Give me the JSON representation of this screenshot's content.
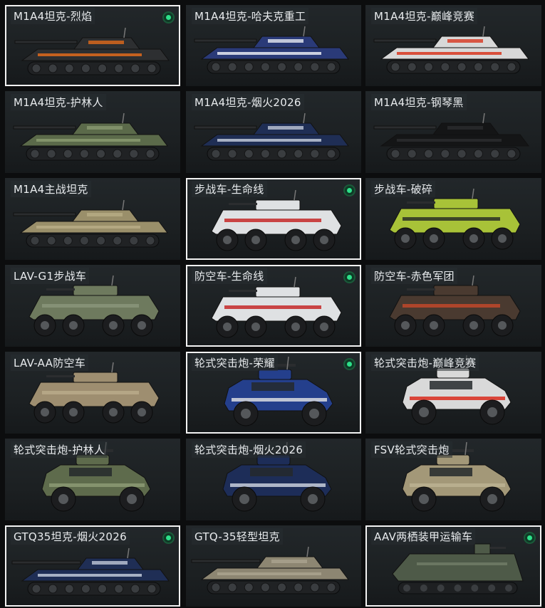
{
  "vehicles": [
    {
      "name": "M1A4坦克-烈焰",
      "selected": true,
      "owned": true,
      "type": "tank",
      "body": "#2d2f31",
      "accent": "#e06a1c"
    },
    {
      "name": "M1A4坦克-哈夫克重工",
      "selected": false,
      "owned": false,
      "type": "tank",
      "body": "#2a3a78",
      "accent": "#e7ebf2"
    },
    {
      "name": "M1A4坦克-巅峰竞赛",
      "selected": false,
      "owned": false,
      "type": "tank",
      "body": "#d8d8d8",
      "accent": "#d8361f"
    },
    {
      "name": "M1A4坦克-护林人",
      "selected": false,
      "owned": false,
      "type": "tank",
      "body": "#5b6a4a",
      "accent": "#8a9a70"
    },
    {
      "name": "M1A4坦克-烟火2026",
      "selected": false,
      "owned": false,
      "type": "tank",
      "body": "#1f2e55",
      "accent": "#c0c8d8"
    },
    {
      "name": "M1A4坦克-钢琴黑",
      "selected": false,
      "owned": false,
      "type": "tank",
      "body": "#141516",
      "accent": "#2a2c2e"
    },
    {
      "name": "M1A4主战坦克",
      "selected": false,
      "owned": false,
      "type": "tank",
      "body": "#9a8f6a",
      "accent": "#b8ad86"
    },
    {
      "name": "步战车-生命线",
      "selected": true,
      "owned": true,
      "type": "ifv",
      "body": "#dfe1e3",
      "accent": "#c62828"
    },
    {
      "name": "步战车-破碎",
      "selected": false,
      "owned": false,
      "type": "ifv",
      "body": "#a8c238",
      "accent": "#2a2f26"
    },
    {
      "name": "LAV-G1步战车",
      "selected": false,
      "owned": false,
      "type": "ifv",
      "body": "#6e7a5e",
      "accent": "#8a957a"
    },
    {
      "name": "防空车-生命线",
      "selected": true,
      "owned": true,
      "type": "ifv",
      "body": "#dfe1e3",
      "accent": "#c62828"
    },
    {
      "name": "防空车-赤色军团",
      "selected": false,
      "owned": false,
      "type": "ifv",
      "body": "#4a3a30",
      "accent": "#c0482a"
    },
    {
      "name": "LAV-AA防空车",
      "selected": false,
      "owned": false,
      "type": "ifv",
      "body": "#9e8e70",
      "accent": "#b9aa8a"
    },
    {
      "name": "轮式突击炮-荣耀",
      "selected": true,
      "owned": true,
      "type": "wheeled",
      "body": "#243f8c",
      "accent": "#d9dce0"
    },
    {
      "name": "轮式突击炮-巅峰竞赛",
      "selected": false,
      "owned": false,
      "type": "wheeled",
      "body": "#d9d9d9",
      "accent": "#d92a1c"
    },
    {
      "name": "轮式突击炮-护林人",
      "selected": false,
      "owned": false,
      "type": "wheeled",
      "body": "#5e6b4c",
      "accent": "#8c9a74"
    },
    {
      "name": "轮式突击炮-烟火2026",
      "selected": false,
      "owned": false,
      "type": "wheeled",
      "body": "#1d2d58",
      "accent": "#c8cfdc"
    },
    {
      "name": "FSV轮式突击炮",
      "selected": false,
      "owned": false,
      "type": "wheeled",
      "body": "#a39878",
      "accent": "#bcb292"
    },
    {
      "name": "GTQ35坦克-烟火2026",
      "selected": true,
      "owned": true,
      "type": "light",
      "body": "#1f2e55",
      "accent": "#c0c8d8"
    },
    {
      "name": "GTQ-35轻型坦克",
      "selected": false,
      "owned": false,
      "type": "light",
      "body": "#8d8672",
      "accent": "#aaa38e"
    },
    {
      "name": "AAV两栖装甲运输车",
      "selected": true,
      "owned": true,
      "type": "aav",
      "body": "#4e5a48",
      "accent": "#6b7762"
    }
  ]
}
